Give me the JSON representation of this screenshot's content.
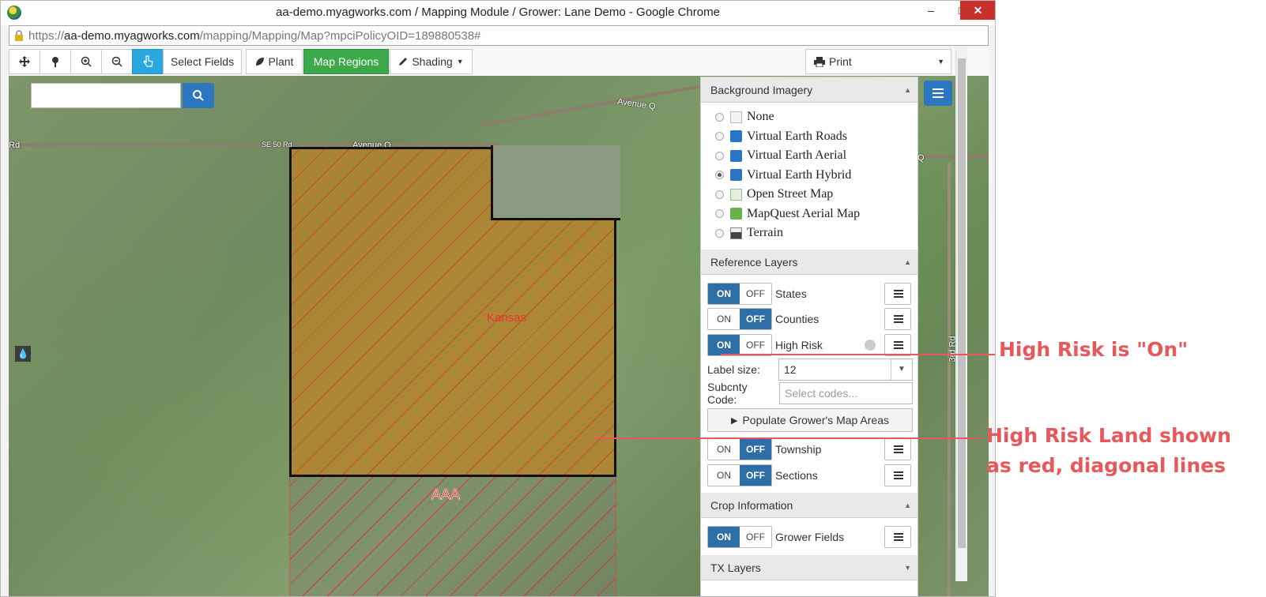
{
  "window": {
    "title": "aa-demo.myagworks.com / Mapping Module / Grower: Lane Demo - Google Chrome",
    "min": "–",
    "max": "□",
    "close": "✕"
  },
  "address": {
    "scheme": "https://",
    "host": "aa-demo.myagworks.com",
    "path": "/mapping/Mapping/Map?mpciPolicyOID=189880538#"
  },
  "toolbar": {
    "select_fields": "Select Fields",
    "plant": "Plant",
    "map_regions": "Map Regions",
    "shading": "Shading",
    "print": "Print"
  },
  "map": {
    "search_placeholder": "",
    "roads": {
      "avenue_q_top": "Avenue Q",
      "avenue_q_mid": "Avenue Q",
      "se50": "SE 50 Rd",
      "rd_left": "Rd",
      "third_rd": "3rd Rd",
      "q_right": "Q"
    },
    "regions": {
      "state_label": "Kansas",
      "aaa_label": "AAA"
    }
  },
  "panel": {
    "background_imagery": {
      "header": "Background Imagery",
      "options": [
        {
          "label": "None",
          "icon": "blank-icon",
          "selected": false
        },
        {
          "label": "Virtual Earth Roads",
          "icon": "bing-icon",
          "selected": false
        },
        {
          "label": "Virtual Earth Aerial",
          "icon": "bing-icon",
          "selected": false
        },
        {
          "label": "Virtual Earth Hybrid",
          "icon": "bing-icon",
          "selected": true
        },
        {
          "label": "Open Street Map",
          "icon": "osm-icon",
          "selected": false
        },
        {
          "label": "MapQuest Aerial Map",
          "icon": "mapquest-icon",
          "selected": false
        },
        {
          "label": "Terrain",
          "icon": "terrain-icon",
          "selected": false
        }
      ]
    },
    "reference_layers": {
      "header": "Reference Layers",
      "on": "ON",
      "off": "OFF",
      "layers": [
        {
          "label": "States",
          "state": "on"
        },
        {
          "label": "Counties",
          "state": "off"
        },
        {
          "label": "High Risk",
          "state": "on"
        }
      ],
      "label_size_label": "Label size:",
      "label_size_value": "12",
      "subcnty_label": "Subcnty Code:",
      "subcnty_placeholder": "Select codes...",
      "populate_button": "Populate Grower's Map Areas",
      "layers2": [
        {
          "label": "Township",
          "state": "off"
        },
        {
          "label": "Sections",
          "state": "off"
        }
      ]
    },
    "crop_information": {
      "header": "Crop Information",
      "layers": [
        {
          "label": "Grower Fields",
          "state": "on"
        }
      ]
    },
    "tx_layers": {
      "header": "TX Layers"
    }
  },
  "annotations": {
    "high_risk_on": "High Risk is \"On\"",
    "high_risk_land_1": "High Risk Land shown",
    "high_risk_land_2": "as red, diagonal lines"
  },
  "colors": {
    "annotation": "#e8575a",
    "toggle_on": "#2e6ea6",
    "map_regions": "#3ca94a",
    "high_risk_lines": "#dc3240"
  }
}
